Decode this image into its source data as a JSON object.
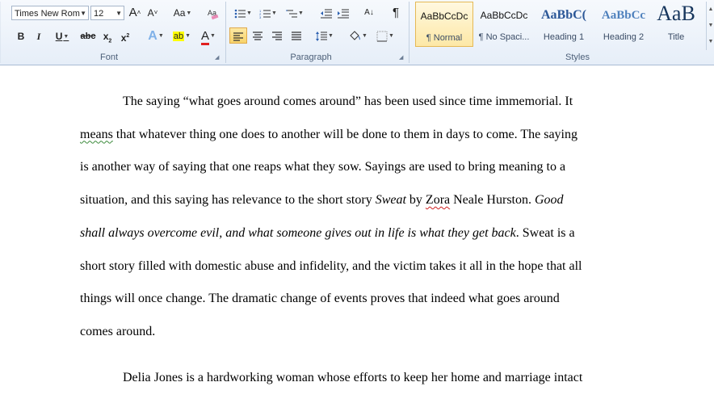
{
  "font_group": {
    "font_name": "Times New Rom",
    "font_size": "12",
    "grow_label": "A",
    "shrink_label": "A",
    "change_case_label": "Aa",
    "bold": "B",
    "italic": "I",
    "underline": "U",
    "strikethrough": "abc",
    "subscript": "x",
    "superscript": "x",
    "text_effects": "A",
    "highlight": "ab",
    "font_color": "A",
    "label": "Font",
    "highlight_color": "#ffff00",
    "font_color_value": "#e02020"
  },
  "paragraph_group": {
    "show_marks": "¶",
    "sort": "A↓",
    "label": "Paragraph"
  },
  "styles_group": {
    "label": "Styles",
    "tiles": [
      {
        "preview": "AaBbCcDc",
        "name": "¶ Normal"
      },
      {
        "preview": "AaBbCcDc",
        "name": "¶ No Spaci..."
      },
      {
        "preview": "AaBbC(",
        "name": "Heading 1"
      },
      {
        "preview": "AaBbCc",
        "name": "Heading 2"
      },
      {
        "preview": "AaB",
        "name": "Title"
      }
    ]
  },
  "document": {
    "paragraph1": [
      {
        "segments": [
          {
            "text": "The saying “what goes around comes around” has been used since time immemorial. It"
          }
        ]
      },
      {
        "segments": [
          {
            "text": "means",
            "style": "squiggle"
          },
          {
            "text": " that whatever thing one does to another will be done to them in days to come. The saying"
          }
        ]
      },
      {
        "segments": [
          {
            "text": "is another way of saying that one reaps what they sow. Sayings are used to bring meaning to a"
          }
        ]
      },
      {
        "segments": [
          {
            "text": "situation, and this saying has relevance to the short story "
          },
          {
            "text": "Sweat",
            "style": "italic"
          },
          {
            "text": " by "
          },
          {
            "text": "Zora",
            "style": "squiggle-red"
          },
          {
            "text": " Neale Hurston. "
          },
          {
            "text": "Good",
            "style": "italic"
          }
        ]
      },
      {
        "segments": [
          {
            "text": "shall always overcome evil, and what someone gives out in life is what they get back",
            "style": "italic"
          },
          {
            "text": ". Sweat is a"
          }
        ]
      },
      {
        "segments": [
          {
            "text": "short story filled with domestic abuse and infidelity, and the victim takes it all in the hope that all"
          }
        ]
      },
      {
        "segments": [
          {
            "text": "things will once change. The dramatic change of events proves that indeed what goes around"
          }
        ]
      },
      {
        "segments": [
          {
            "text": "comes around."
          }
        ]
      }
    ],
    "paragraph2": [
      {
        "segments": [
          {
            "text": "Delia Jones is a hardworking woman whose efforts to keep her home and marriage intact"
          }
        ]
      }
    ]
  }
}
